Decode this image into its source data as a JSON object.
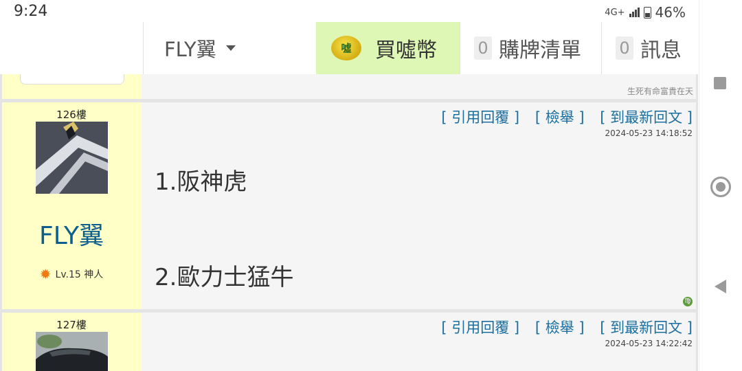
{
  "status_bar": {
    "time": "9:24",
    "network": "4G+",
    "battery": "46%"
  },
  "top_nav": {
    "user_name": "FLY翼",
    "coin_icon": "coin-icon",
    "coin_label": "買噓幣",
    "cart_count": "0",
    "cart_label": "購牌清單",
    "message_count": "0",
    "message_label": "訊息"
  },
  "previous_post": {
    "signature": "生死有命富貴在天"
  },
  "posts": [
    {
      "floor": "126樓",
      "username": "FLY翼",
      "level": "Lv.15 神人",
      "actions": [
        "引用回覆",
        "檢舉",
        "到最新回文"
      ],
      "timestamp": "2024-05-23 14:18:52",
      "content": [
        "1.阪神虎",
        "2.歐力士猛牛"
      ],
      "zodiac": "♍"
    },
    {
      "floor": "127樓",
      "actions": [
        "引用回覆",
        "檢舉",
        "到最新回文"
      ],
      "timestamp": "2024-05-23 14:22:42"
    }
  ],
  "colors": {
    "accent_blue": "#1b6fa0",
    "username_blue": "#0b5f8f",
    "sidebar_yellow": "#ffffc8",
    "coin_green": "#dff7b5"
  }
}
